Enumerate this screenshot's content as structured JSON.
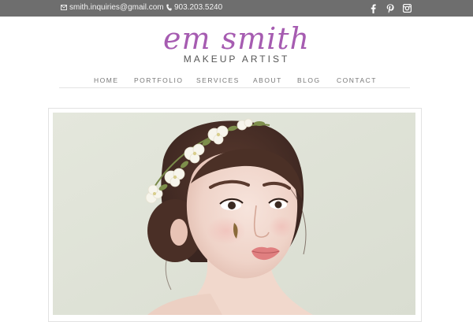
{
  "topbar": {
    "email": "smith.inquiries@gmail.com",
    "phone": "903.203.5240",
    "background": "#6e6e6e",
    "social_icons": [
      "facebook-icon",
      "pinterest-icon",
      "instagram-icon"
    ]
  },
  "logo": {
    "script_text": "em smith",
    "subtitle": "MAKEUP ARTIST",
    "accent": "#a65cb1"
  },
  "nav": {
    "items": [
      {
        "label": "HOME"
      },
      {
        "label": "PORTFOLIO"
      },
      {
        "label": "SERVICES"
      },
      {
        "label": "ABOUT"
      },
      {
        "label": "BLOG"
      },
      {
        "label": "CONTACT"
      }
    ]
  },
  "hero": {
    "subject": "portrait-photo"
  }
}
